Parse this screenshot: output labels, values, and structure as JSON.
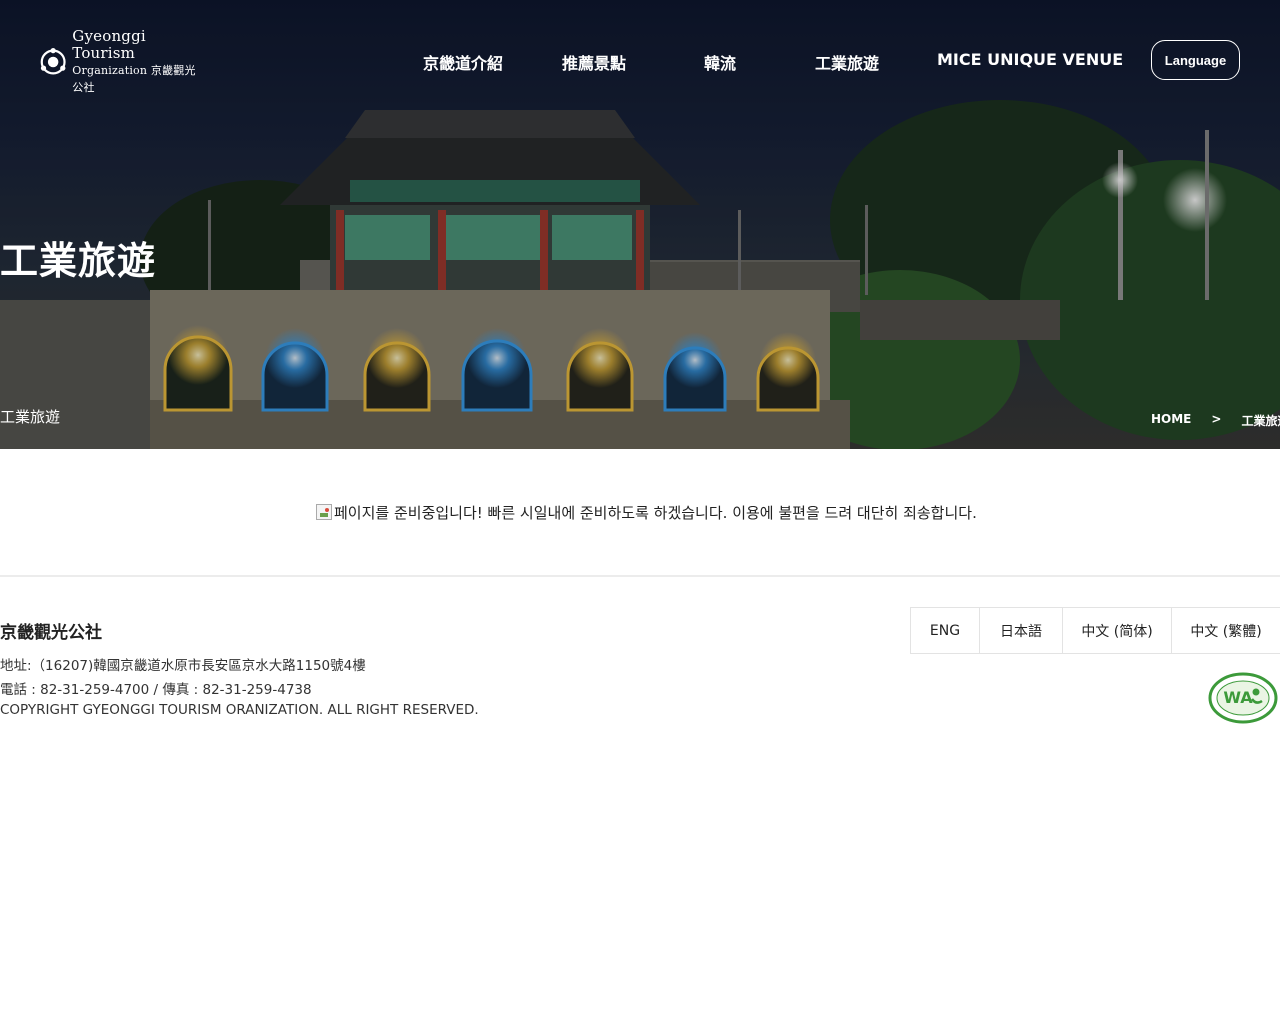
{
  "header": {
    "logo_line1": "Gyeonggi Tourism",
    "logo_line2": "Organization 京畿觀光公社",
    "nav": [
      {
        "label": "京畿道介紹"
      },
      {
        "label": "推薦景點"
      },
      {
        "label": "韓流"
      },
      {
        "label": "工業旅遊"
      },
      {
        "label": "MICE UNIQUE VENUE"
      }
    ],
    "language_button": "Language"
  },
  "hero": {
    "title": "工業旅遊",
    "subtitle": "工業旅遊",
    "breadcrumb": {
      "home": "HOME",
      "separator": ">",
      "current": "工業旅遊"
    }
  },
  "notice": {
    "text": "페이지를 준비중입니다! 빠른 시일내에 준비하도록 하겠습니다. 이용에 불편을 드려 대단히 죄송합니다."
  },
  "footer": {
    "org_name": "京畿觀光公社",
    "address": "地址:（16207)韓國京畿道水原市長安區京水大路1150號4樓",
    "phone": "電話 : 82-31-259-4700 / 傳真 : 82-31-259-4738",
    "copyright": "COPYRIGHT GYEONGGI TOURISM ORANIZATION. ALL RIGHT RESERVED.",
    "languages": [
      {
        "label": "ENG"
      },
      {
        "label": "日本語"
      },
      {
        "label": "中文 (简体)"
      },
      {
        "label": "中文 (繁體)"
      }
    ],
    "badge_text": "WA"
  },
  "colors": {
    "badge_green": "#3c9a3a",
    "footer_border": "#e3e3e3"
  }
}
